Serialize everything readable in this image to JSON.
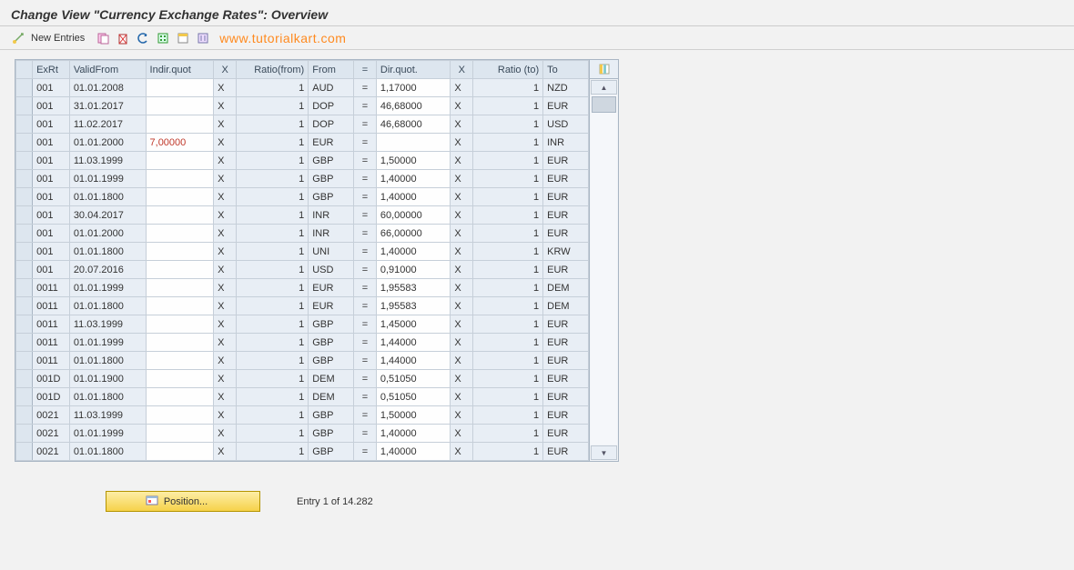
{
  "header": {
    "title": "Change View \"Currency Exchange Rates\": Overview"
  },
  "toolbar": {
    "new_entries": "New Entries",
    "watermark": "www.tutorialkart.com"
  },
  "table": {
    "headers": {
      "exrt": "ExRt",
      "validfrom": "ValidFrom",
      "indir": "Indir.quot",
      "x1": "X",
      "ratiofrom": "Ratio(from)",
      "from": "From",
      "eq": "=",
      "dir": "Dir.quot.",
      "x2": "X",
      "ratioto": "Ratio (to)",
      "to": "To"
    },
    "rows": [
      {
        "exrt": "001",
        "valid": "01.01.2008",
        "indir": "",
        "x1": "X",
        "rfrom": "1",
        "from": "AUD",
        "eq": "=",
        "dir": "1,17000",
        "x2": "X",
        "rto": "1",
        "to": "NZD"
      },
      {
        "exrt": "001",
        "valid": "31.01.2017",
        "indir": "",
        "x1": "X",
        "rfrom": "1",
        "from": "DOP",
        "eq": "=",
        "dir": "46,68000",
        "x2": "X",
        "rto": "1",
        "to": "EUR"
      },
      {
        "exrt": "001",
        "valid": "11.02.2017",
        "indir": "",
        "x1": "X",
        "rfrom": "1",
        "from": "DOP",
        "eq": "=",
        "dir": "46,68000",
        "x2": "X",
        "rto": "1",
        "to": "USD"
      },
      {
        "exrt": "001",
        "valid": "01.01.2000",
        "indir": "7,00000",
        "indir_red": true,
        "x1": "X",
        "rfrom": "1",
        "from": "EUR",
        "eq": "=",
        "dir": "",
        "x2": "X",
        "rto": "1",
        "to": "INR"
      },
      {
        "exrt": "001",
        "valid": "11.03.1999",
        "indir": "",
        "x1": "X",
        "rfrom": "1",
        "from": "GBP",
        "eq": "=",
        "dir": "1,50000",
        "x2": "X",
        "rto": "1",
        "to": "EUR"
      },
      {
        "exrt": "001",
        "valid": "01.01.1999",
        "indir": "",
        "x1": "X",
        "rfrom": "1",
        "from": "GBP",
        "eq": "=",
        "dir": "1,40000",
        "x2": "X",
        "rto": "1",
        "to": "EUR"
      },
      {
        "exrt": "001",
        "valid": "01.01.1800",
        "indir": "",
        "x1": "X",
        "rfrom": "1",
        "from": "GBP",
        "eq": "=",
        "dir": "1,40000",
        "x2": "X",
        "rto": "1",
        "to": "EUR"
      },
      {
        "exrt": "001",
        "valid": "30.04.2017",
        "indir": "",
        "x1": "X",
        "rfrom": "1",
        "from": "INR",
        "eq": "=",
        "dir": "60,00000",
        "x2": "X",
        "rto": "1",
        "to": "EUR"
      },
      {
        "exrt": "001",
        "valid": "01.01.2000",
        "indir": "",
        "x1": "X",
        "rfrom": "1",
        "from": "INR",
        "eq": "=",
        "dir": "66,00000",
        "x2": "X",
        "rto": "1",
        "to": "EUR"
      },
      {
        "exrt": "001",
        "valid": "01.01.1800",
        "indir": "",
        "x1": "X",
        "rfrom": "1",
        "from": "UNI",
        "eq": "=",
        "dir": "1,40000",
        "x2": "X",
        "rto": "1",
        "to": "KRW"
      },
      {
        "exrt": "001",
        "valid": "20.07.2016",
        "indir": "",
        "x1": "X",
        "rfrom": "1",
        "from": "USD",
        "eq": "=",
        "dir": "0,91000",
        "x2": "X",
        "rto": "1",
        "to": "EUR"
      },
      {
        "exrt": "0011",
        "valid": "01.01.1999",
        "indir": "",
        "x1": "X",
        "rfrom": "1",
        "from": "EUR",
        "eq": "=",
        "dir": "1,95583",
        "x2": "X",
        "rto": "1",
        "to": "DEM"
      },
      {
        "exrt": "0011",
        "valid": "01.01.1800",
        "indir": "",
        "x1": "X",
        "rfrom": "1",
        "from": "EUR",
        "eq": "=",
        "dir": "1,95583",
        "x2": "X",
        "rto": "1",
        "to": "DEM"
      },
      {
        "exrt": "0011",
        "valid": "11.03.1999",
        "indir": "",
        "x1": "X",
        "rfrom": "1",
        "from": "GBP",
        "eq": "=",
        "dir": "1,45000",
        "x2": "X",
        "rto": "1",
        "to": "EUR"
      },
      {
        "exrt": "0011",
        "valid": "01.01.1999",
        "indir": "",
        "x1": "X",
        "rfrom": "1",
        "from": "GBP",
        "eq": "=",
        "dir": "1,44000",
        "x2": "X",
        "rto": "1",
        "to": "EUR"
      },
      {
        "exrt": "0011",
        "valid": "01.01.1800",
        "indir": "",
        "x1": "X",
        "rfrom": "1",
        "from": "GBP",
        "eq": "=",
        "dir": "1,44000",
        "x2": "X",
        "rto": "1",
        "to": "EUR"
      },
      {
        "exrt": "001D",
        "valid": "01.01.1900",
        "indir": "",
        "x1": "X",
        "rfrom": "1",
        "from": "DEM",
        "eq": "=",
        "dir": "0,51050",
        "x2": "X",
        "rto": "1",
        "to": "EUR"
      },
      {
        "exrt": "001D",
        "valid": "01.01.1800",
        "indir": "",
        "x1": "X",
        "rfrom": "1",
        "from": "DEM",
        "eq": "=",
        "dir": "0,51050",
        "x2": "X",
        "rto": "1",
        "to": "EUR"
      },
      {
        "exrt": "0021",
        "valid": "11.03.1999",
        "indir": "",
        "x1": "X",
        "rfrom": "1",
        "from": "GBP",
        "eq": "=",
        "dir": "1,50000",
        "x2": "X",
        "rto": "1",
        "to": "EUR"
      },
      {
        "exrt": "0021",
        "valid": "01.01.1999",
        "indir": "",
        "x1": "X",
        "rfrom": "1",
        "from": "GBP",
        "eq": "=",
        "dir": "1,40000",
        "x2": "X",
        "rto": "1",
        "to": "EUR"
      },
      {
        "exrt": "0021",
        "valid": "01.01.1800",
        "indir": "",
        "x1": "X",
        "rfrom": "1",
        "from": "GBP",
        "eq": "=",
        "dir": "1,40000",
        "x2": "X",
        "rto": "1",
        "to": "EUR"
      }
    ]
  },
  "footer": {
    "position_label": "Position...",
    "entry_text": "Entry 1 of 14.282"
  }
}
